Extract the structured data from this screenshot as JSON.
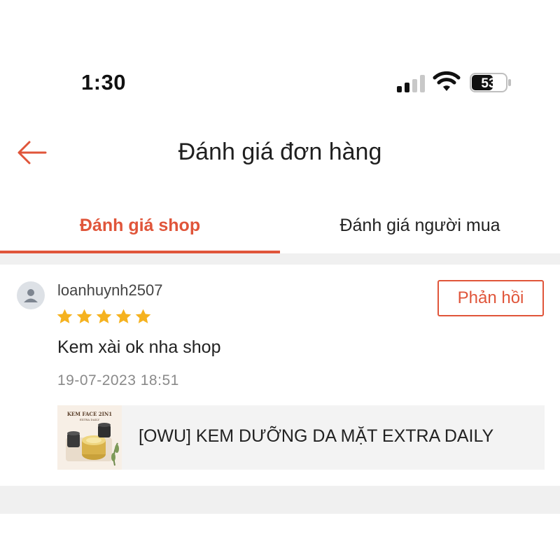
{
  "status_bar": {
    "time": "1:30",
    "battery": "53",
    "icons": [
      "signal-icon",
      "wifi-icon",
      "battery-icon"
    ]
  },
  "header": {
    "title": "Đánh giá đơn hàng",
    "back_icon": "arrow-left-icon"
  },
  "tabs": [
    {
      "label": "Đánh giá shop",
      "active": true
    },
    {
      "label": "Đánh giá người mua",
      "active": false
    }
  ],
  "review": {
    "username": "loanhuynh2507",
    "rating": 5,
    "rating_max": 5,
    "comment": "Kem xài ok nha shop",
    "date": "19-07-2023 18:51",
    "reply_label": "Phản hồi",
    "product": {
      "thumb_title": "KEM FACE 2IN1",
      "thumb_subtitle": "EXTRA DAILY",
      "name": "[OWU] KEM DƯỠNG DA MẶT EXTRA DAILY"
    }
  },
  "colors": {
    "accent": "#e0553a",
    "star": "#f5b21f",
    "divider": "#f0f0f0"
  }
}
